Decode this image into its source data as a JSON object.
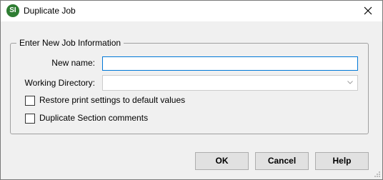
{
  "window": {
    "title": "Duplicate Job",
    "app_icon_text": "SI",
    "accent_color": "#0078d7"
  },
  "group": {
    "legend": "Enter New Job Information",
    "new_name_label": "New name:",
    "new_name_value": "",
    "working_dir_label": "Working Directory:",
    "working_dir_value": "",
    "restore_label": "Restore print settings to default values",
    "restore_checked": false,
    "duplicate_comments_label": "Duplicate Section comments",
    "duplicate_comments_checked": false
  },
  "buttons": {
    "ok": "OK",
    "cancel": "Cancel",
    "help": "Help"
  },
  "icons": {
    "close": "close-icon",
    "app": "app-logo-icon",
    "dropdown": "chevron-down-icon",
    "resize": "resize-grip-icon"
  }
}
